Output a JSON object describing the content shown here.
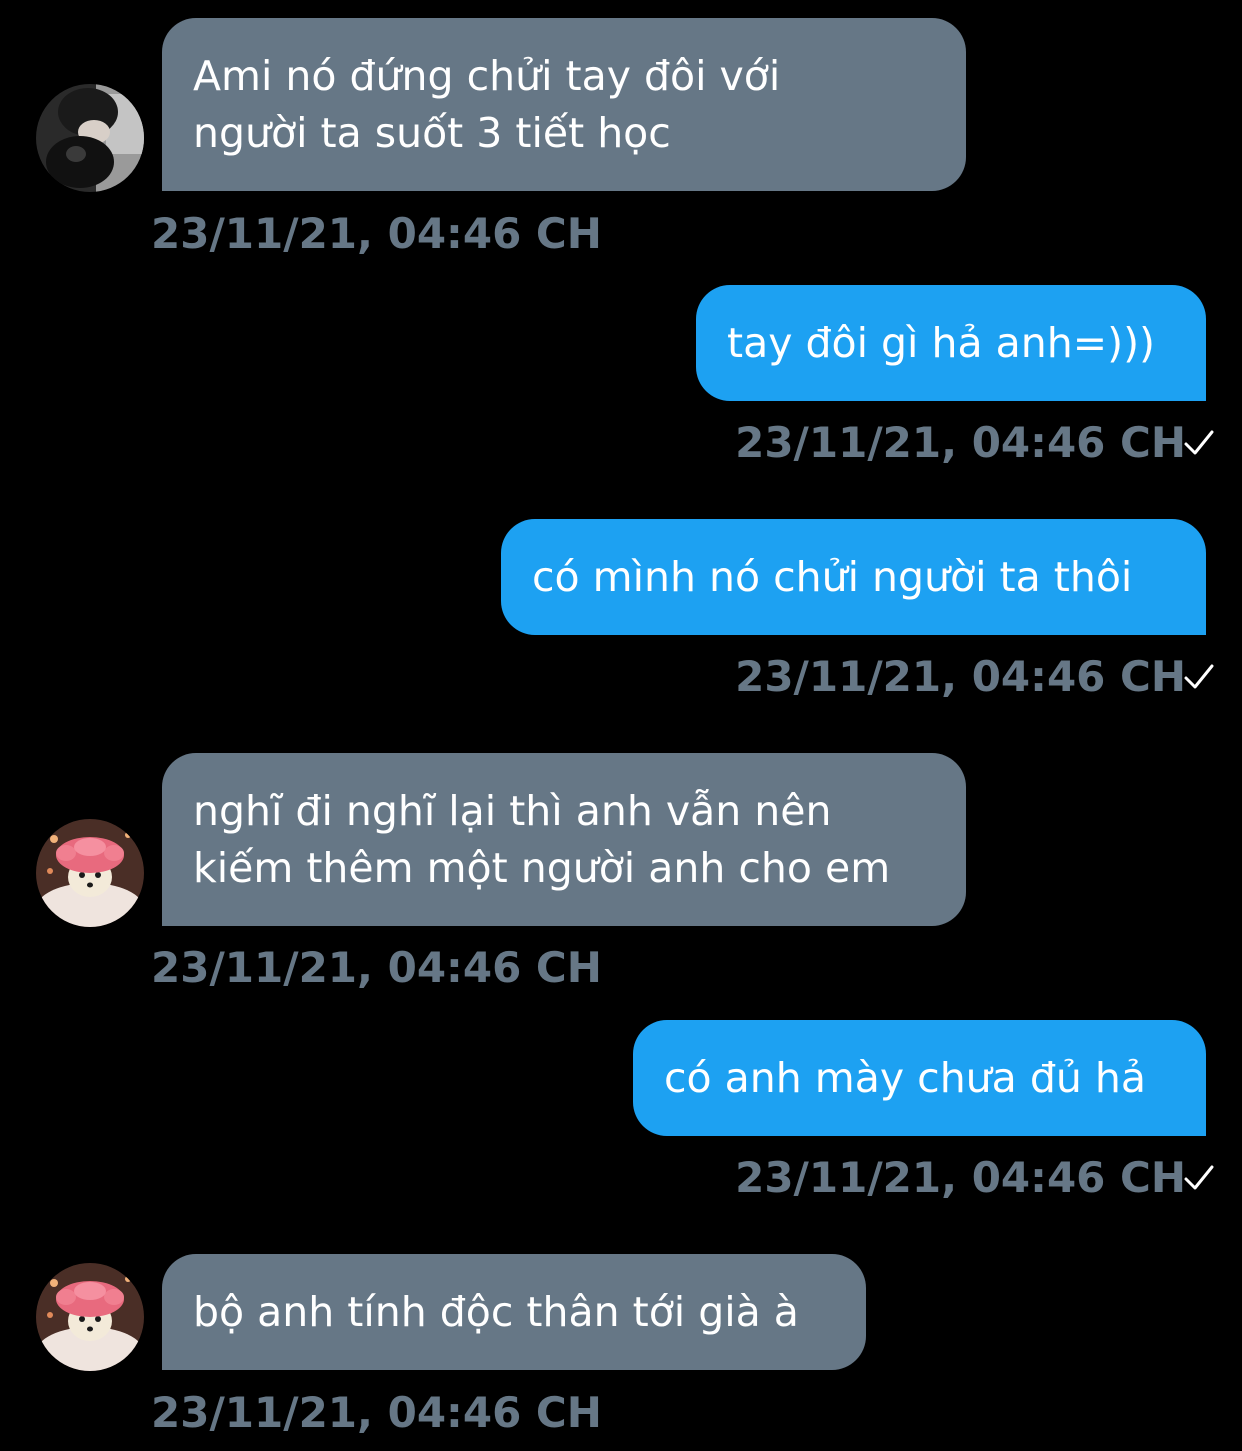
{
  "messages": [
    {
      "id": 1,
      "direction": "incoming",
      "avatar": "avatar-person-with-cat",
      "lines": [
        "Ami nó đứng chửi tay đôi với",
        "người ta suốt 3 tiết học"
      ],
      "timestamp": "23/11/21, 04:46 CH"
    },
    {
      "id": 2,
      "direction": "outgoing",
      "lines": [
        "tay đôi gì hả anh=)))"
      ],
      "timestamp": "23/11/21, 04:46 CH",
      "status_icon": "checkmark-icon"
    },
    {
      "id": 3,
      "direction": "outgoing",
      "lines": [
        "có mình nó chửi người ta thôi"
      ],
      "timestamp": "23/11/21, 04:46 CH",
      "status_icon": "checkmark-icon"
    },
    {
      "id": 4,
      "direction": "incoming",
      "avatar": "avatar-dog-pink-cap",
      "lines": [
        "nghĩ đi nghĩ lại thì anh vẫn nên",
        "kiếm thêm một người anh cho em"
      ],
      "timestamp": "23/11/21, 04:46 CH"
    },
    {
      "id": 5,
      "direction": "outgoing",
      "lines": [
        "có anh mày chưa đủ hả"
      ],
      "timestamp": "23/11/21, 04:46 CH",
      "status_icon": "checkmark-icon"
    },
    {
      "id": 6,
      "direction": "incoming",
      "avatar": "avatar-dog-pink-cap",
      "lines": [
        "bộ anh tính độc thân tới già à"
      ],
      "timestamp": "23/11/21, 04:46 CH"
    }
  ],
  "colors": {
    "background": "#000000",
    "incoming_bubble": "#667786",
    "outgoing_bubble": "#1da1f2",
    "timestamp": "#667786",
    "text": "#ffffff"
  }
}
